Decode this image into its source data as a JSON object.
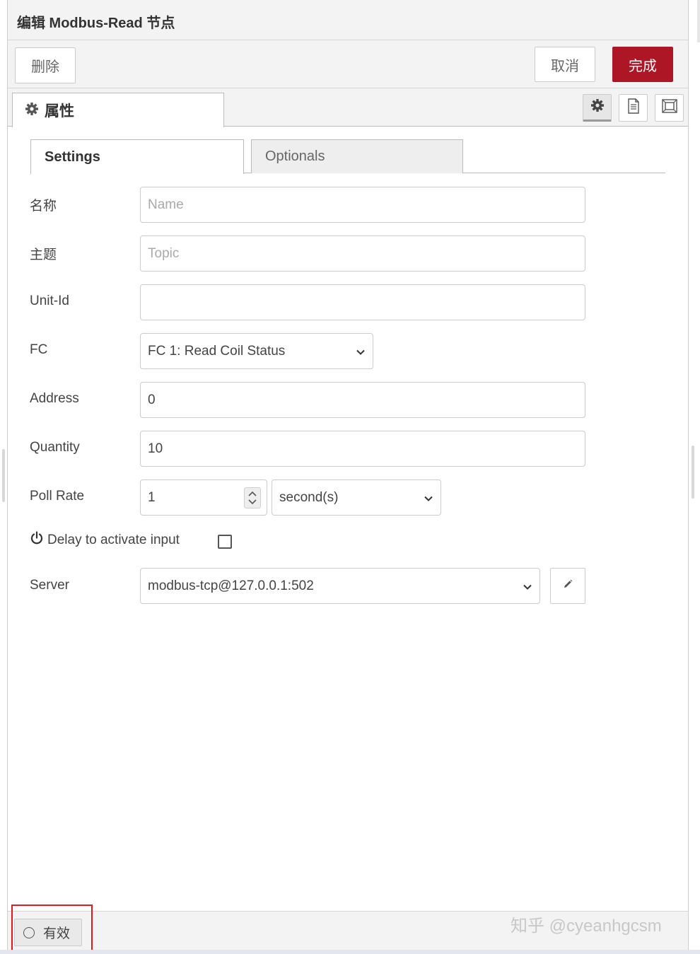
{
  "tray": {
    "title": "编辑 Modbus-Read 节点",
    "delete_label": "删除",
    "cancel_label": "取消",
    "done_label": "完成",
    "accent_color": "#ad1625"
  },
  "tabs": {
    "properties_label": "属性",
    "icons": [
      "gear-icon",
      "document-icon",
      "frame-icon"
    ]
  },
  "subtabs": {
    "settings_label": "Settings",
    "optionals_label": "Optionals"
  },
  "form": {
    "name": {
      "label": "名称",
      "placeholder": "Name",
      "value": ""
    },
    "topic": {
      "label": "主题",
      "placeholder": "Topic",
      "value": ""
    },
    "unit_id": {
      "label": "Unit-Id",
      "value": ""
    },
    "fc": {
      "label": "FC",
      "value": "FC 1: Read Coil Status"
    },
    "address": {
      "label": "Address",
      "value": "0"
    },
    "quantity": {
      "label": "Quantity",
      "value": "10"
    },
    "poll_rate": {
      "label": "Poll Rate",
      "value": "1",
      "unit": "second(s)"
    },
    "delay": {
      "label": "Delay to activate input",
      "checked": false
    },
    "server": {
      "label": "Server",
      "value": "modbus-tcp@127.0.0.1:502"
    }
  },
  "footer": {
    "enabled_label": "有效"
  },
  "watermark": "知乎 @cyeanhgcsm"
}
